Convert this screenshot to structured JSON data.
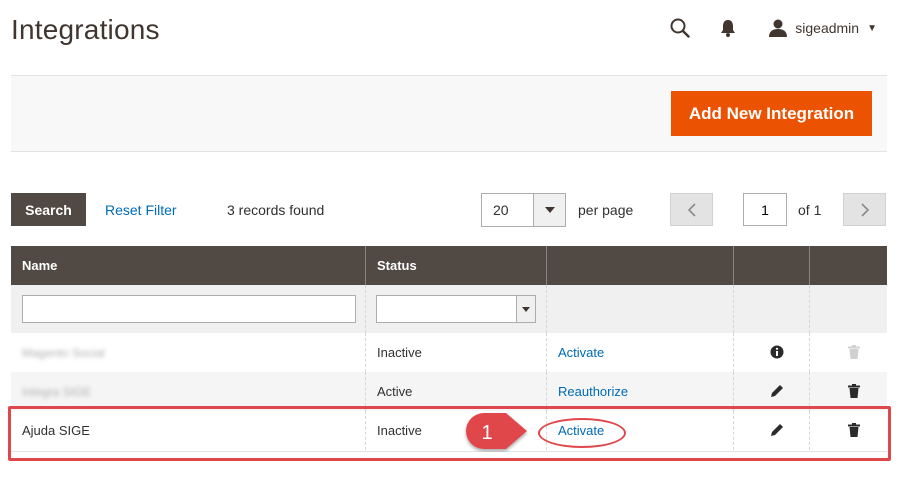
{
  "page": {
    "title": "Integrations"
  },
  "header": {
    "username": "sigeadmin"
  },
  "actions": {
    "add_new_label": "Add New Integration"
  },
  "grid_controls": {
    "search_label": "Search",
    "reset_filter_label": "Reset Filter",
    "records_found": "3 records found",
    "per_page_value": "20",
    "per_page_label": "per page",
    "current_page": "1",
    "of_pages": "of 1"
  },
  "columns": {
    "name": "Name",
    "status": "Status"
  },
  "rows": [
    {
      "name": "Magento Social",
      "status": "Inactive",
      "action": "Activate",
      "row_icon": "info-icon",
      "delete_enabled": false
    },
    {
      "name": "Integra SIGE",
      "status": "Active",
      "action": "Reauthorize",
      "row_icon": "pencil-icon",
      "delete_enabled": true
    },
    {
      "name": "Ajuda SIGE",
      "status": "Inactive",
      "action": "Activate",
      "row_icon": "pencil-icon",
      "delete_enabled": true
    }
  ],
  "annotation": {
    "badge_number": "1"
  },
  "colors": {
    "primary_button": "#eb5202",
    "grid_header": "#514943",
    "link": "#006bb4",
    "highlight": "#e0474c"
  }
}
